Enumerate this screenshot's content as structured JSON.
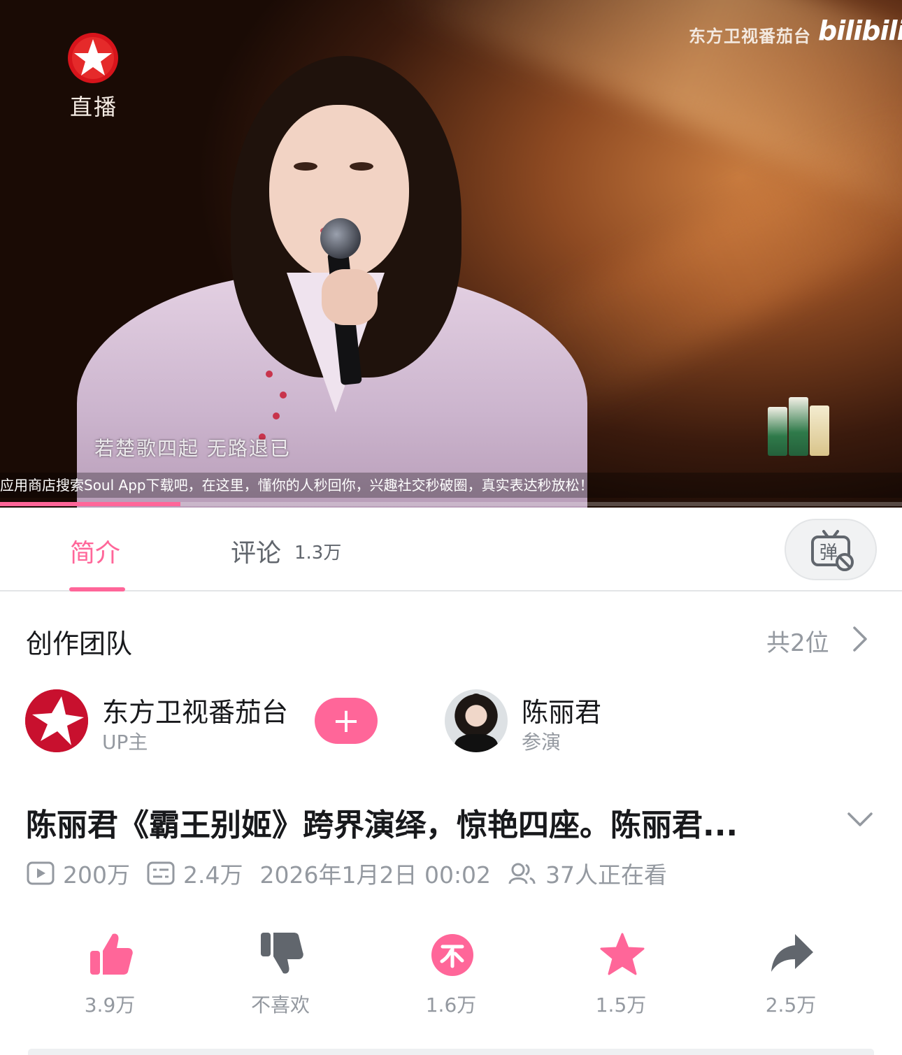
{
  "player": {
    "channel_label": "直播",
    "watermark_text": "东方卫视番茄台",
    "watermark_brand": "bilibili",
    "lyric": "若楚歌四起 无路退已",
    "ticker": "应用商店搜索Soul App下载吧，在这里，懂你的人秒回你，兴趣社交秒破圈，真实表达秒放松！",
    "progress": 0.2
  },
  "tabs": {
    "intro_label": "简介",
    "comments_label": "评论",
    "comments_count": "1.3万"
  },
  "creators": {
    "title": "创作团队",
    "count": "共2位",
    "up": {
      "name": "东方卫视番茄台",
      "role": "UP主",
      "follow_symbol": "+"
    },
    "actor": {
      "name": "陈丽君",
      "role": "参演"
    }
  },
  "video": {
    "title": "陈丽君《霸王别姬》跨界演绎，惊艳四座。陈丽君...",
    "views": "200万",
    "danmaku": "2.4万",
    "date": "2026年1月2日 00:02",
    "watching": "37人正在看"
  },
  "actions": {
    "like": "3.9万",
    "dislike": "不喜欢",
    "coin": "1.6万",
    "favorite": "1.5万",
    "share": "2.5万"
  },
  "colors": {
    "accent": "#ff6699",
    "muted_text": "#9499a0",
    "channel_red": "#c8102e"
  }
}
